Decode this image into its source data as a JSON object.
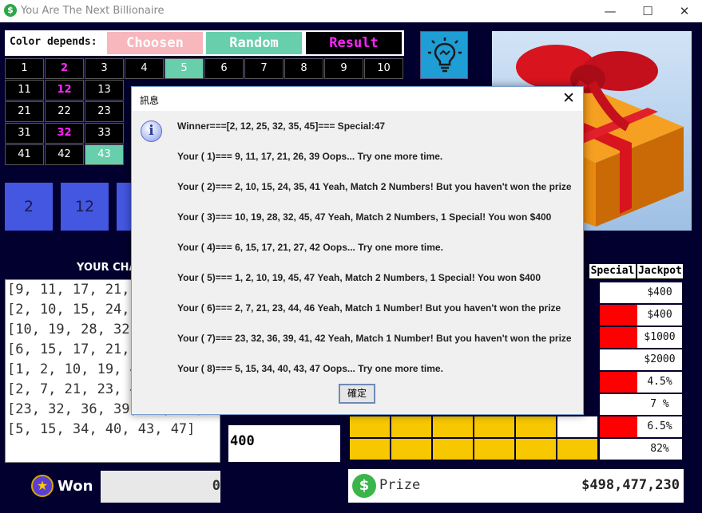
{
  "window": {
    "title": "You Are The Next Billionaire",
    "minimize": "—",
    "maximize": "☐",
    "close": "✕",
    "app_icon": "$"
  },
  "color_legend": {
    "label": "Color depends:",
    "chosen": "Choosen",
    "random": "Random",
    "result": "Result"
  },
  "number_grid": [
    [
      "1",
      "2",
      "3",
      "4",
      "5",
      "6",
      "7",
      "8",
      "9",
      "10"
    ],
    [
      "11",
      "12",
      "13"
    ],
    [
      "21",
      "22",
      "23"
    ],
    [
      "31",
      "32",
      "33"
    ],
    [
      "41",
      "42",
      "43"
    ]
  ],
  "picked_numbers": [
    "2",
    "12"
  ],
  "chances_title": "YOUR CHANCES",
  "tickets": [
    "[9, 11, 17, 21, 26, 39]",
    "[2, 10, 15, 24, 35, 41]",
    "[10, 19, 28, 32, 45, 47]",
    "[6, 15, 17, 21, 27, 42]",
    "[1, 2, 10, 19, 45, 47]",
    "[2, 7, 21, 23, 44, 46]",
    "[23, 32, 36, 39, 41, 42]",
    "[5, 15, 34, 40, 43, 47]"
  ],
  "amount": "400",
  "prize_table": {
    "headers": {
      "special": "Special",
      "jackpot": "Jackpot"
    },
    "rows": [
      {
        "value": "$400",
        "special_red": false,
        "fill_fraction": 0
      },
      {
        "value": "$400",
        "special_red": true,
        "fill_fraction": 0
      },
      {
        "value": "$1000",
        "special_red": true,
        "fill_fraction": 0
      },
      {
        "value": "$2000",
        "special_red": false,
        "fill_fraction": 0
      },
      {
        "value": "4.5%",
        "special_red": true,
        "fill_fraction": 0
      },
      {
        "value": "7 %",
        "special_red": false,
        "fill_fraction": 0
      },
      {
        "value": "6.5%",
        "special_red": true,
        "fill_fraction": 0.83
      },
      {
        "value": "82%",
        "special_red": false,
        "fill_fraction": 1
      }
    ]
  },
  "won": {
    "label": "Won",
    "value": "0"
  },
  "prize": {
    "label": "Prize",
    "value": "$498,477,230",
    "icon": "$"
  },
  "dialog": {
    "title": "訊息",
    "close": "✕",
    "icon": "i",
    "lines": [
      "Winner===[2, 12, 25, 32, 35, 45]=== Special:47",
      "Your ( 1)=== 9, 11, 17, 21, 26, 39     Oops... Try one more time.",
      "Your ( 2)=== 2, 10, 15, 24, 35, 41     Yeah, Match 2 Numbers! But you haven't won the prize",
      "Your ( 3)=== 10, 19, 28, 32, 45, 47     Yeah, Match 2 Numbers, 1 Special! You won $400",
      "Your ( 4)=== 6, 15, 17, 21, 27, 42     Oops... Try one more time.",
      "Your ( 5)=== 1, 2, 10, 19, 45, 47     Yeah, Match 2 Numbers, 1 Special! You won $400",
      "Your ( 6)=== 2, 7, 21, 23, 44, 46     Yeah, Match 1 Number! But you haven't won the prize",
      "Your ( 7)=== 23, 32, 36, 39, 41, 42     Yeah, Match 1 Number! But you haven't won the prize",
      "Your ( 8)=== 5, 15, 34, 40, 43, 47     Oops... Try one more time."
    ],
    "ok": "確定"
  },
  "colors": {
    "chosen": "#f8b6bd",
    "random": "#67cfab",
    "result": "#ff26ff",
    "background": "#02002e",
    "picked": "#4357e0",
    "special": "#ff0000",
    "bar": "#f7c700"
  }
}
